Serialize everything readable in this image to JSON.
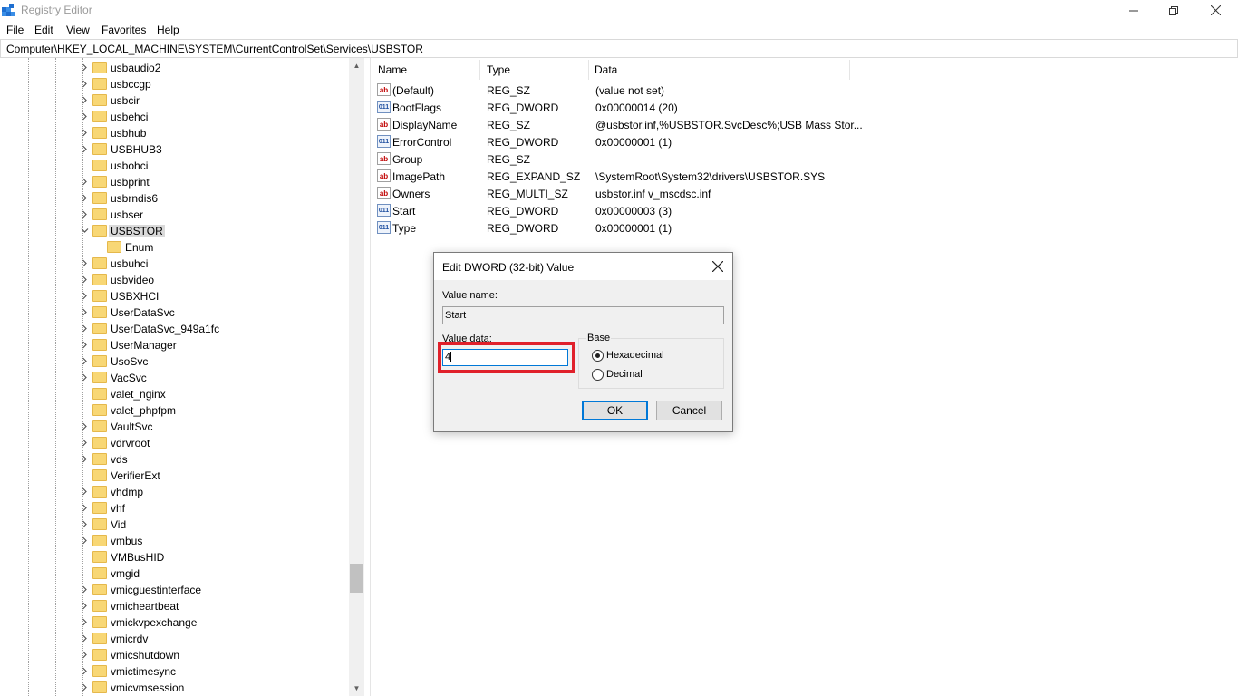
{
  "window": {
    "title": "Registry Editor"
  },
  "menu": [
    "File",
    "Edit",
    "View",
    "Favorites",
    "Help"
  ],
  "address": "Computer\\HKEY_LOCAL_MACHINE\\SYSTEM\\CurrentControlSet\\Services\\USBSTOR",
  "tree": {
    "items": [
      {
        "label": "usbaudio2",
        "expandable": true
      },
      {
        "label": "usbccgp",
        "expandable": true
      },
      {
        "label": "usbcir",
        "expandable": true
      },
      {
        "label": "usbehci",
        "expandable": true
      },
      {
        "label": "usbhub",
        "expandable": true
      },
      {
        "label": "USBHUB3",
        "expandable": true
      },
      {
        "label": "usbohci",
        "expandable": false
      },
      {
        "label": "usbprint",
        "expandable": true
      },
      {
        "label": "usbrndis6",
        "expandable": true
      },
      {
        "label": "usbser",
        "expandable": true
      },
      {
        "label": "USBSTOR",
        "expandable": true,
        "expanded": true,
        "selected": true
      },
      {
        "label": "Enum",
        "expandable": false,
        "child": true
      },
      {
        "label": "usbuhci",
        "expandable": true
      },
      {
        "label": "usbvideo",
        "expandable": true
      },
      {
        "label": "USBXHCI",
        "expandable": true
      },
      {
        "label": "UserDataSvc",
        "expandable": true
      },
      {
        "label": "UserDataSvc_949a1fc",
        "expandable": true
      },
      {
        "label": "UserManager",
        "expandable": true
      },
      {
        "label": "UsoSvc",
        "expandable": true
      },
      {
        "label": "VacSvc",
        "expandable": true
      },
      {
        "label": "valet_nginx",
        "expandable": false
      },
      {
        "label": "valet_phpfpm",
        "expandable": false
      },
      {
        "label": "VaultSvc",
        "expandable": true
      },
      {
        "label": "vdrvroot",
        "expandable": true
      },
      {
        "label": "vds",
        "expandable": true
      },
      {
        "label": "VerifierExt",
        "expandable": false
      },
      {
        "label": "vhdmp",
        "expandable": true
      },
      {
        "label": "vhf",
        "expandable": true
      },
      {
        "label": "Vid",
        "expandable": true
      },
      {
        "label": "vmbus",
        "expandable": true
      },
      {
        "label": "VMBusHID",
        "expandable": false
      },
      {
        "label": "vmgid",
        "expandable": false
      },
      {
        "label": "vmicguestinterface",
        "expandable": true
      },
      {
        "label": "vmicheartbeat",
        "expandable": true
      },
      {
        "label": "vmickvpexchange",
        "expandable": true
      },
      {
        "label": "vmicrdv",
        "expandable": true
      },
      {
        "label": "vmicshutdown",
        "expandable": true
      },
      {
        "label": "vmictimesync",
        "expandable": true
      },
      {
        "label": "vmicvmsession",
        "expandable": true
      }
    ]
  },
  "columns": {
    "name": "Name",
    "type": "Type",
    "data": "Data"
  },
  "values": [
    {
      "icon": "string-value-icon",
      "kind": "sz",
      "name": "(Default)",
      "type": "REG_SZ",
      "data": "(value not set)"
    },
    {
      "icon": "dword-value-icon",
      "kind": "dw",
      "name": "BootFlags",
      "type": "REG_DWORD",
      "data": "0x00000014 (20)"
    },
    {
      "icon": "string-value-icon",
      "kind": "sz",
      "name": "DisplayName",
      "type": "REG_SZ",
      "data": "@usbstor.inf,%USBSTOR.SvcDesc%;USB Mass Stor..."
    },
    {
      "icon": "dword-value-icon",
      "kind": "dw",
      "name": "ErrorControl",
      "type": "REG_DWORD",
      "data": "0x00000001 (1)"
    },
    {
      "icon": "string-value-icon",
      "kind": "sz",
      "name": "Group",
      "type": "REG_SZ",
      "data": ""
    },
    {
      "icon": "string-value-icon",
      "kind": "sz",
      "name": "ImagePath",
      "type": "REG_EXPAND_SZ",
      "data": "\\SystemRoot\\System32\\drivers\\USBSTOR.SYS"
    },
    {
      "icon": "string-value-icon",
      "kind": "sz",
      "name": "Owners",
      "type": "REG_MULTI_SZ",
      "data": "usbstor.inf v_mscdsc.inf"
    },
    {
      "icon": "dword-value-icon",
      "kind": "dw",
      "name": "Start",
      "type": "REG_DWORD",
      "data": "0x00000003 (3)"
    },
    {
      "icon": "dword-value-icon",
      "kind": "dw",
      "name": "Type",
      "type": "REG_DWORD",
      "data": "0x00000001 (1)"
    }
  ],
  "dialog": {
    "title": "Edit DWORD (32-bit) Value",
    "value_name_label": "Value name:",
    "value_name": "Start",
    "value_data_label": "Value data:",
    "value_data": "4",
    "base_label": "Base",
    "hex_label": "Hexadecimal",
    "dec_label": "Decimal",
    "selected_base": "Hexadecimal",
    "ok_label": "OK",
    "cancel_label": "Cancel",
    "highlight_color": "#e0202a"
  },
  "colors": {
    "folder": "#f8d775",
    "selection": "#d9d9d9",
    "focus": "#0078d7"
  }
}
